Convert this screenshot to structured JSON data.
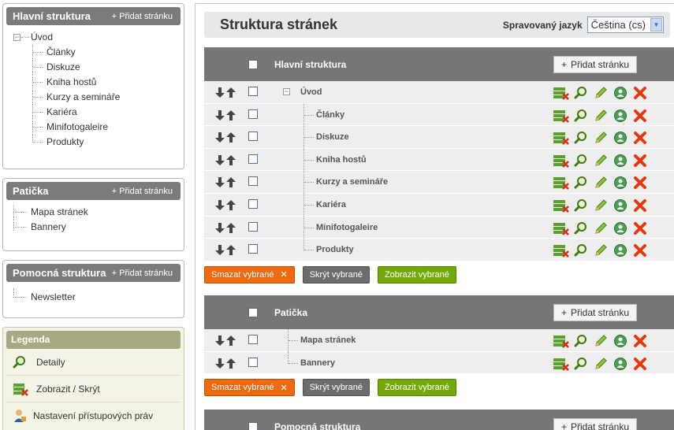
{
  "sidebar": {
    "main": {
      "title": "Hlavní struktura",
      "add_label": "+ Přidat stránku",
      "root": "Úvod",
      "children": [
        "Články",
        "Diskuze",
        "Kniha hostů",
        "Kurzy a semináře",
        "Kariéra",
        "Minifotogaleire",
        "Produkty"
      ]
    },
    "footer": {
      "title": "Patička",
      "add_label": "+ Přidat stránku",
      "items": [
        "Mapa stránek",
        "Bannery"
      ]
    },
    "aux": {
      "title": "Pomocná struktura",
      "add_label": "+ Přidat stránku",
      "items": [
        "Newsletter"
      ]
    },
    "legend": {
      "title": "Legenda",
      "items": [
        {
          "label": "Detaily",
          "icon": "magnifier-icon"
        },
        {
          "label": "Zobrazit / Skrýt",
          "icon": "show-hide-icon"
        },
        {
          "label": "Nastavení přístupových práv",
          "icon": "user-access-icon"
        }
      ]
    }
  },
  "main": {
    "title": "Struktura stránek",
    "language_label": "Spravovaný jazyk",
    "language_value": "Čeština (cs)",
    "sections": [
      {
        "name": "Hlavní struktura",
        "add_label": "Přidat stránku",
        "rows": [
          "Úvod",
          "Články",
          "Diskuze",
          "Kniha hostů",
          "Kurzy a semináře",
          "Kariéra",
          "Minifotogaleire",
          "Produkty"
        ]
      },
      {
        "name": "Patička",
        "add_label": "Přidat stránku",
        "rows": [
          "Mapa stránek",
          "Bannery"
        ]
      },
      {
        "name": "Pomocná struktura",
        "add_label": "Přidat stránku",
        "rows": []
      }
    ],
    "actions": {
      "delete_label": "Smazat vybrané",
      "hide_label": "Skrýt vybrané",
      "show_label": "Zobrazit vybrané"
    }
  },
  "colors": {
    "header_gray": "#767676",
    "delete_orange": "#ee6a10",
    "show_green": "#74a90a",
    "hide_gray": "#6c6c6c",
    "legend_olive": "#a8a882"
  }
}
